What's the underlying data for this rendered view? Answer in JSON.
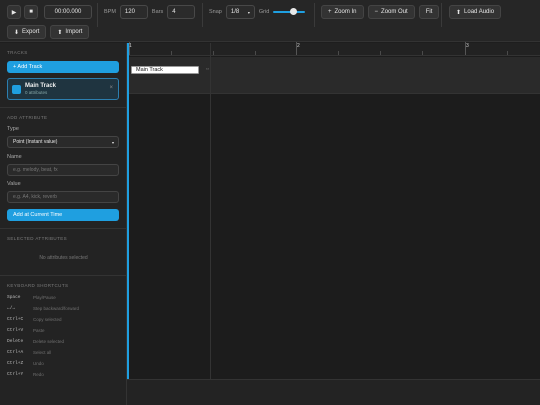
{
  "toolbar": {
    "time": "00:00.000",
    "bpm_label": "BPM",
    "bpm_value": "120",
    "bars_label": "Bars",
    "bars_value": "4",
    "snap_label": "Snap",
    "snap_value": "1/8",
    "grid_label": "Grid",
    "zoom_in": "Zoom In",
    "zoom_out": "Zoom Out",
    "fit": "Fit",
    "load_audio": "Load Audio",
    "export": "Export",
    "import": "Import"
  },
  "sidebar": {
    "tracks_title": "TRACKS",
    "add_track": "+ Add Track",
    "track": {
      "name": "Main Track",
      "sub": "0 attributes",
      "color": "#1f9fe0"
    },
    "add_attr_title": "ADD ATTRIBUTE",
    "type_label": "Type",
    "type_value": "Point (Instant value)",
    "name_label": "Name",
    "name_placeholder": "e.g. melody, beat, fx",
    "value_label": "Value",
    "value_placeholder": "e.g. A4, kick, reverb",
    "add_at_time": "Add at Current Time",
    "selected_title": "SELECTED ATTRIBUTES",
    "no_selected": "No attributes selected",
    "shortcuts_title": "KEYBOARD SHORTCUTS",
    "shortcuts": [
      {
        "key": "Space",
        "desc": "Play/Pause"
      },
      {
        "key": "←/→",
        "desc": "Step backward/forward"
      },
      {
        "key": "Ctrl+C",
        "desc": "Copy selected"
      },
      {
        "key": "Ctrl+V",
        "desc": "Paste"
      },
      {
        "key": "Delete",
        "desc": "Delete selected"
      },
      {
        "key": "Ctrl+A",
        "desc": "Select all"
      },
      {
        "key": "Ctrl+Z",
        "desc": "Undo"
      },
      {
        "key": "Ctrl+Y",
        "desc": "Redo"
      }
    ]
  },
  "timeline": {
    "bars": [
      "1",
      "2",
      "3"
    ],
    "track_label": "Main Track",
    "accent": "#1f9fe0"
  }
}
